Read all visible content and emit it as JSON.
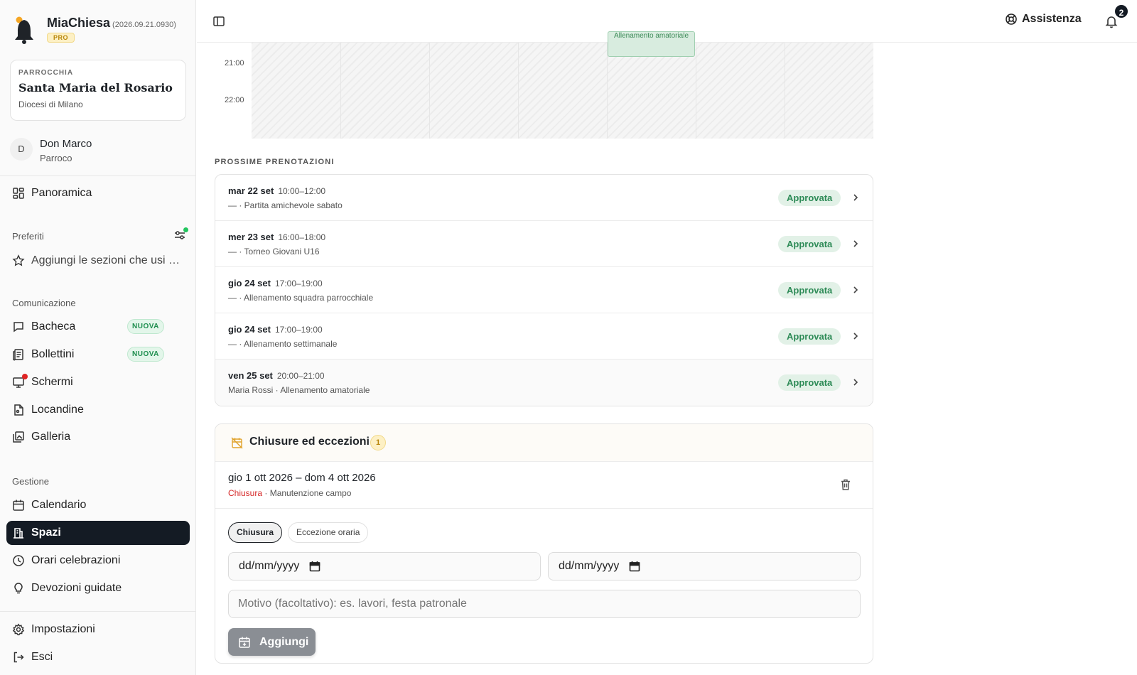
{
  "app": {
    "name": "MiaChiesa",
    "version": "(2026.09.21.0930)",
    "plan": "PRO"
  },
  "parish": {
    "label": "PARROCCHIA",
    "name": "Santa Maria del Rosario",
    "diocese": "Diocesi di Milano"
  },
  "user": {
    "initial": "D",
    "name": "Don Marco",
    "role": "Parroco"
  },
  "nav": {
    "overview": "Panoramica",
    "favorites_title": "Preferiti",
    "favorites_add": "Aggiungi le sezioni che usi di più",
    "communication_title": "Comunicazione",
    "bacheca": "Bacheca",
    "bollettini": "Bollettini",
    "new_badge": "NUOVA",
    "schermi": "Schermi",
    "locandine": "Locandine",
    "galleria": "Galleria",
    "management_title": "Gestione",
    "calendario": "Calendario",
    "spazi": "Spazi",
    "orari": "Orari celebrazioni",
    "devozioni": "Devozioni guidate",
    "impostazioni": "Impostazioni",
    "esci": "Esci"
  },
  "topbar": {
    "help": "Assistenza",
    "notifications_count": "2"
  },
  "calendar": {
    "times": [
      "21:00",
      "22:00"
    ],
    "event_label": "Allenamento amatoriale"
  },
  "upcoming": {
    "title": "PROSSIME PRENOTAZIONI",
    "items": [
      {
        "date": "mar 22 set",
        "time": "10:00–12:00",
        "desc": "— · Partita amichevole sabato",
        "status": "Approvata"
      },
      {
        "date": "mer 23 set",
        "time": "16:00–18:00",
        "desc": "— · Torneo Giovani U16",
        "status": "Approvata"
      },
      {
        "date": "gio 24 set",
        "time": "17:00–19:00",
        "desc": "— · Allenamento squadra parrocchiale",
        "status": "Approvata"
      },
      {
        "date": "gio 24 set",
        "time": "17:00–19:00",
        "desc": "— · Allenamento settimanale",
        "status": "Approvata"
      },
      {
        "date": "ven 25 set",
        "time": "20:00–21:00",
        "desc": "Maria Rossi · Allenamento amatoriale",
        "status": "Approvata"
      }
    ]
  },
  "closures": {
    "title": "Chiusure ed eccezioni",
    "count": "1",
    "item": {
      "range": "gio 1 ott 2026 – dom 4 ott 2026",
      "type": "Chiusura",
      "reason": "· Manutenzione campo"
    },
    "tab_closure": "Chiusura",
    "tab_exception": "Eccezione oraria",
    "date_placeholder": "dd/mm/yyyy",
    "reason_placeholder": "Motivo (facoltativo): es. lavori, festa patronale",
    "add_button": "Aggiungi"
  },
  "colors": {
    "active_nav": "#141b24",
    "approved_text": "#2e8b57",
    "approved_bg": "#e2f1e7",
    "new_badge": "#1e8e4e",
    "closure_red": "#d62828",
    "pro_gold": "#b8860b"
  }
}
